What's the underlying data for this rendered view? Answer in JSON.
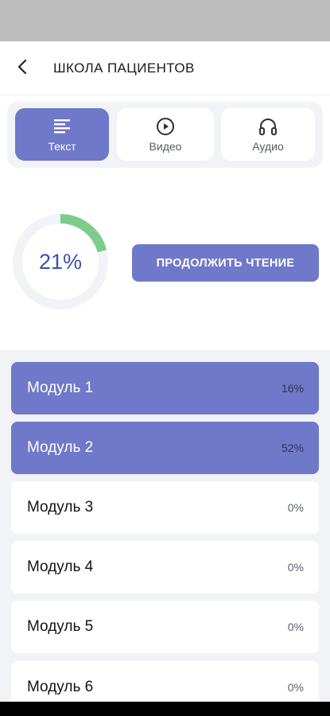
{
  "header": {
    "title": "ШКОЛА ПАЦИЕНТОВ",
    "back_icon": "chevron-left-icon"
  },
  "tabs": [
    {
      "label": "Текст",
      "icon": "text-lines-icon",
      "active": true
    },
    {
      "label": "Видео",
      "icon": "play-circle-icon",
      "active": false
    },
    {
      "label": "Аудио",
      "icon": "headphones-icon",
      "active": false
    }
  ],
  "progress": {
    "value_text": "21%",
    "fraction": 0.21,
    "color": "#7dcc8e",
    "track_color": "#f1f3f7"
  },
  "continue_button": {
    "label": "ПРОДОЛЖИТЬ ЧТЕНИЕ"
  },
  "modules": [
    {
      "name": "Модуль 1",
      "percent": "16%",
      "started": true
    },
    {
      "name": "Модуль 2",
      "percent": "52%",
      "started": true
    },
    {
      "name": "Модуль 3",
      "percent": "0%",
      "started": false
    },
    {
      "name": "Модуль 4",
      "percent": "0%",
      "started": false
    },
    {
      "name": "Модуль 5",
      "percent": "0%",
      "started": false
    },
    {
      "name": "Модуль 6",
      "percent": "0%",
      "started": false
    }
  ],
  "colors": {
    "accent": "#6f78c9",
    "progress_text": "#3f4fae"
  }
}
